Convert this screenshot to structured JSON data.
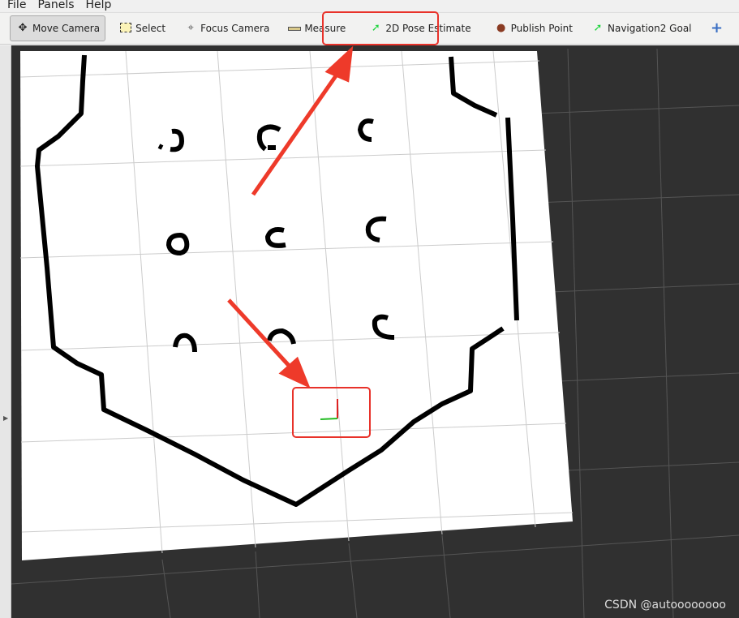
{
  "menu": [
    "File",
    "Panels",
    "Help"
  ],
  "toolbar": {
    "tools": [
      {
        "label": "Move Camera",
        "icon": "move-camera-icon",
        "active": true
      },
      {
        "label": "Select",
        "icon": "select-icon"
      },
      {
        "label": "Focus Camera",
        "icon": "focus-camera-icon"
      },
      {
        "label": "Measure",
        "icon": "ruler-icon"
      },
      {
        "label": "2D Pose Estimate",
        "icon": "green-arrow-icon"
      },
      {
        "label": "Publish Point",
        "icon": "map-pin-icon"
      },
      {
        "label": "Navigation2 Goal",
        "icon": "green-arrow-icon"
      }
    ],
    "add_icon": "plus-icon",
    "remove_icon": "minus-icon"
  },
  "colors": {
    "annotation": "#e8322a",
    "map_free": "#ffffff",
    "map_occupied": "#000000",
    "background": "#303030"
  },
  "watermark": "CSDN @autoooooooo"
}
